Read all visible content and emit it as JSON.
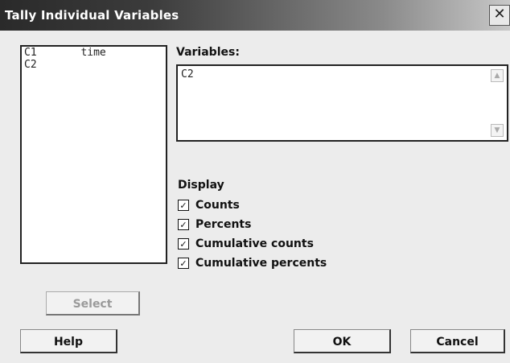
{
  "window": {
    "title": "Tally Individual Variables",
    "close_glyph": "✕"
  },
  "columns_list": [
    "C1       time",
    "C2"
  ],
  "variables": {
    "label": "Variables:",
    "value": "C2",
    "scroll_up_glyph": "▲",
    "scroll_down_glyph": "▼"
  },
  "display": {
    "label": "Display",
    "options": [
      {
        "label": "Counts",
        "checked": true
      },
      {
        "label": "Percents",
        "checked": true
      },
      {
        "label": "Cumulative counts",
        "checked": true
      },
      {
        "label": "Cumulative percents",
        "checked": true
      }
    ],
    "check_glyph": "✓"
  },
  "buttons": {
    "select": "Select",
    "help": "Help",
    "ok": "OK",
    "cancel": "Cancel"
  }
}
